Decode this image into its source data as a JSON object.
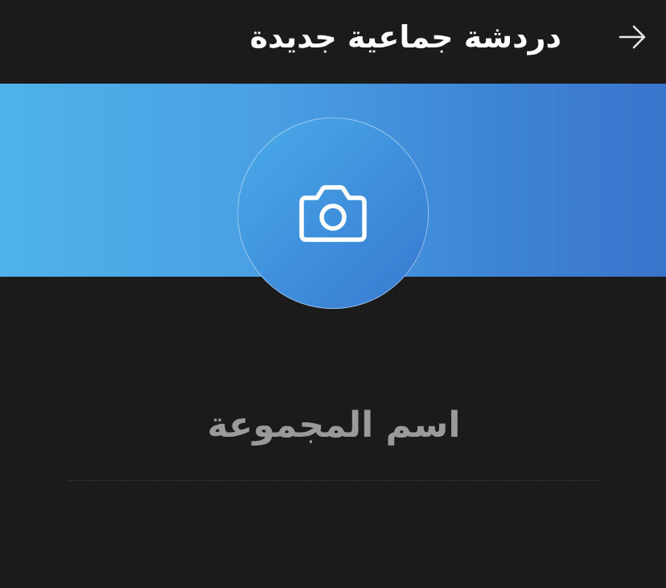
{
  "header": {
    "title": "دردشة جماعية جديدة",
    "back_icon": "arrow-right-icon"
  },
  "avatar": {
    "icon": "camera-icon"
  },
  "group_name": {
    "value": "",
    "placeholder": "اسم المجموعة"
  },
  "colors": {
    "background": "#1b1b1b",
    "banner_start": "#4fb2ea",
    "banner_end": "#3a74cc",
    "placeholder_text": "#9a9a9a",
    "title_text": "#ffffff"
  }
}
